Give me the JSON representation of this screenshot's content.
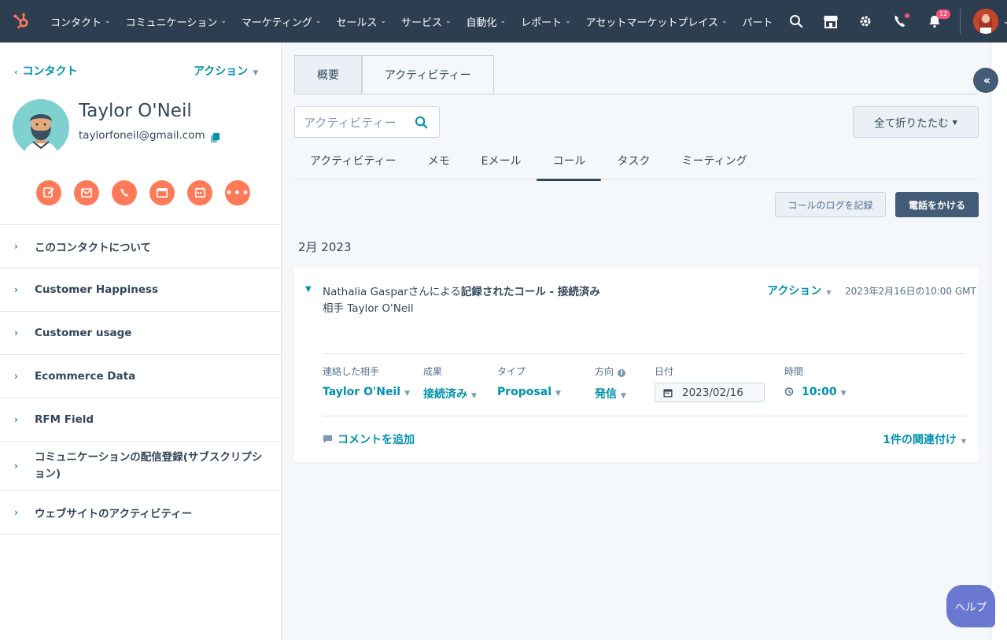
{
  "nav": {
    "items": [
      "コンタクト",
      "コミュニケーション",
      "マーケティング",
      "セールス",
      "サービス",
      "自動化",
      "レポート",
      "アセットマーケットプレイス",
      "パート"
    ],
    "notification_count": "12"
  },
  "sidebar": {
    "back_label": "コンタクト",
    "actions_label": "アクション",
    "name": "Taylor O'Neil",
    "email": "taylorfoneil@gmail.com",
    "sections": [
      "このコンタクトについて",
      "Customer Happiness",
      "Customer usage",
      "Ecommerce Data",
      "RFM Field",
      "コミュニケーションの配信登録(サブスクリプション)",
      "ウェブサイトのアクティビティー"
    ]
  },
  "main": {
    "tabs": [
      "概要",
      "アクティビティー"
    ],
    "search_placeholder": "アクティビティー",
    "collapse_all": "全て折りたたむ",
    "filter_tabs": [
      "アクティビティー",
      "メモ",
      "Eメール",
      "コール",
      "タスク",
      "ミーティング"
    ],
    "log_call": "コールのログを記録",
    "make_call": "電話をかける",
    "month": "2月 2023"
  },
  "card": {
    "title_prefix": "Nathalia Gasparさんによる",
    "title_bold": "記録されたコール - 接続済み",
    "subtitle": "相手 Taylor O'Neil",
    "action": "アクション",
    "date": "2023年2月16日の10:00 GMT",
    "fields": {
      "contact_label": "連絡した相手",
      "contact_value": "Taylor O'Neil",
      "outcome_label": "成果",
      "outcome_value": "接続済み",
      "type_label": "タイプ",
      "type_value": "Proposal",
      "direction_label": "方向",
      "direction_value": "発信",
      "date_label": "日付",
      "date_value": "2023/02/16",
      "time_label": "時間",
      "time_value": "10:00"
    },
    "add_comment": "コメントを追加",
    "associations": "1件の関連付け"
  },
  "help_label": "ヘルプ",
  "colors": {
    "nav_bg": "#2d3e50",
    "accent": "#0091ae",
    "orange": "#ff7a59",
    "help": "#6a78d1"
  }
}
